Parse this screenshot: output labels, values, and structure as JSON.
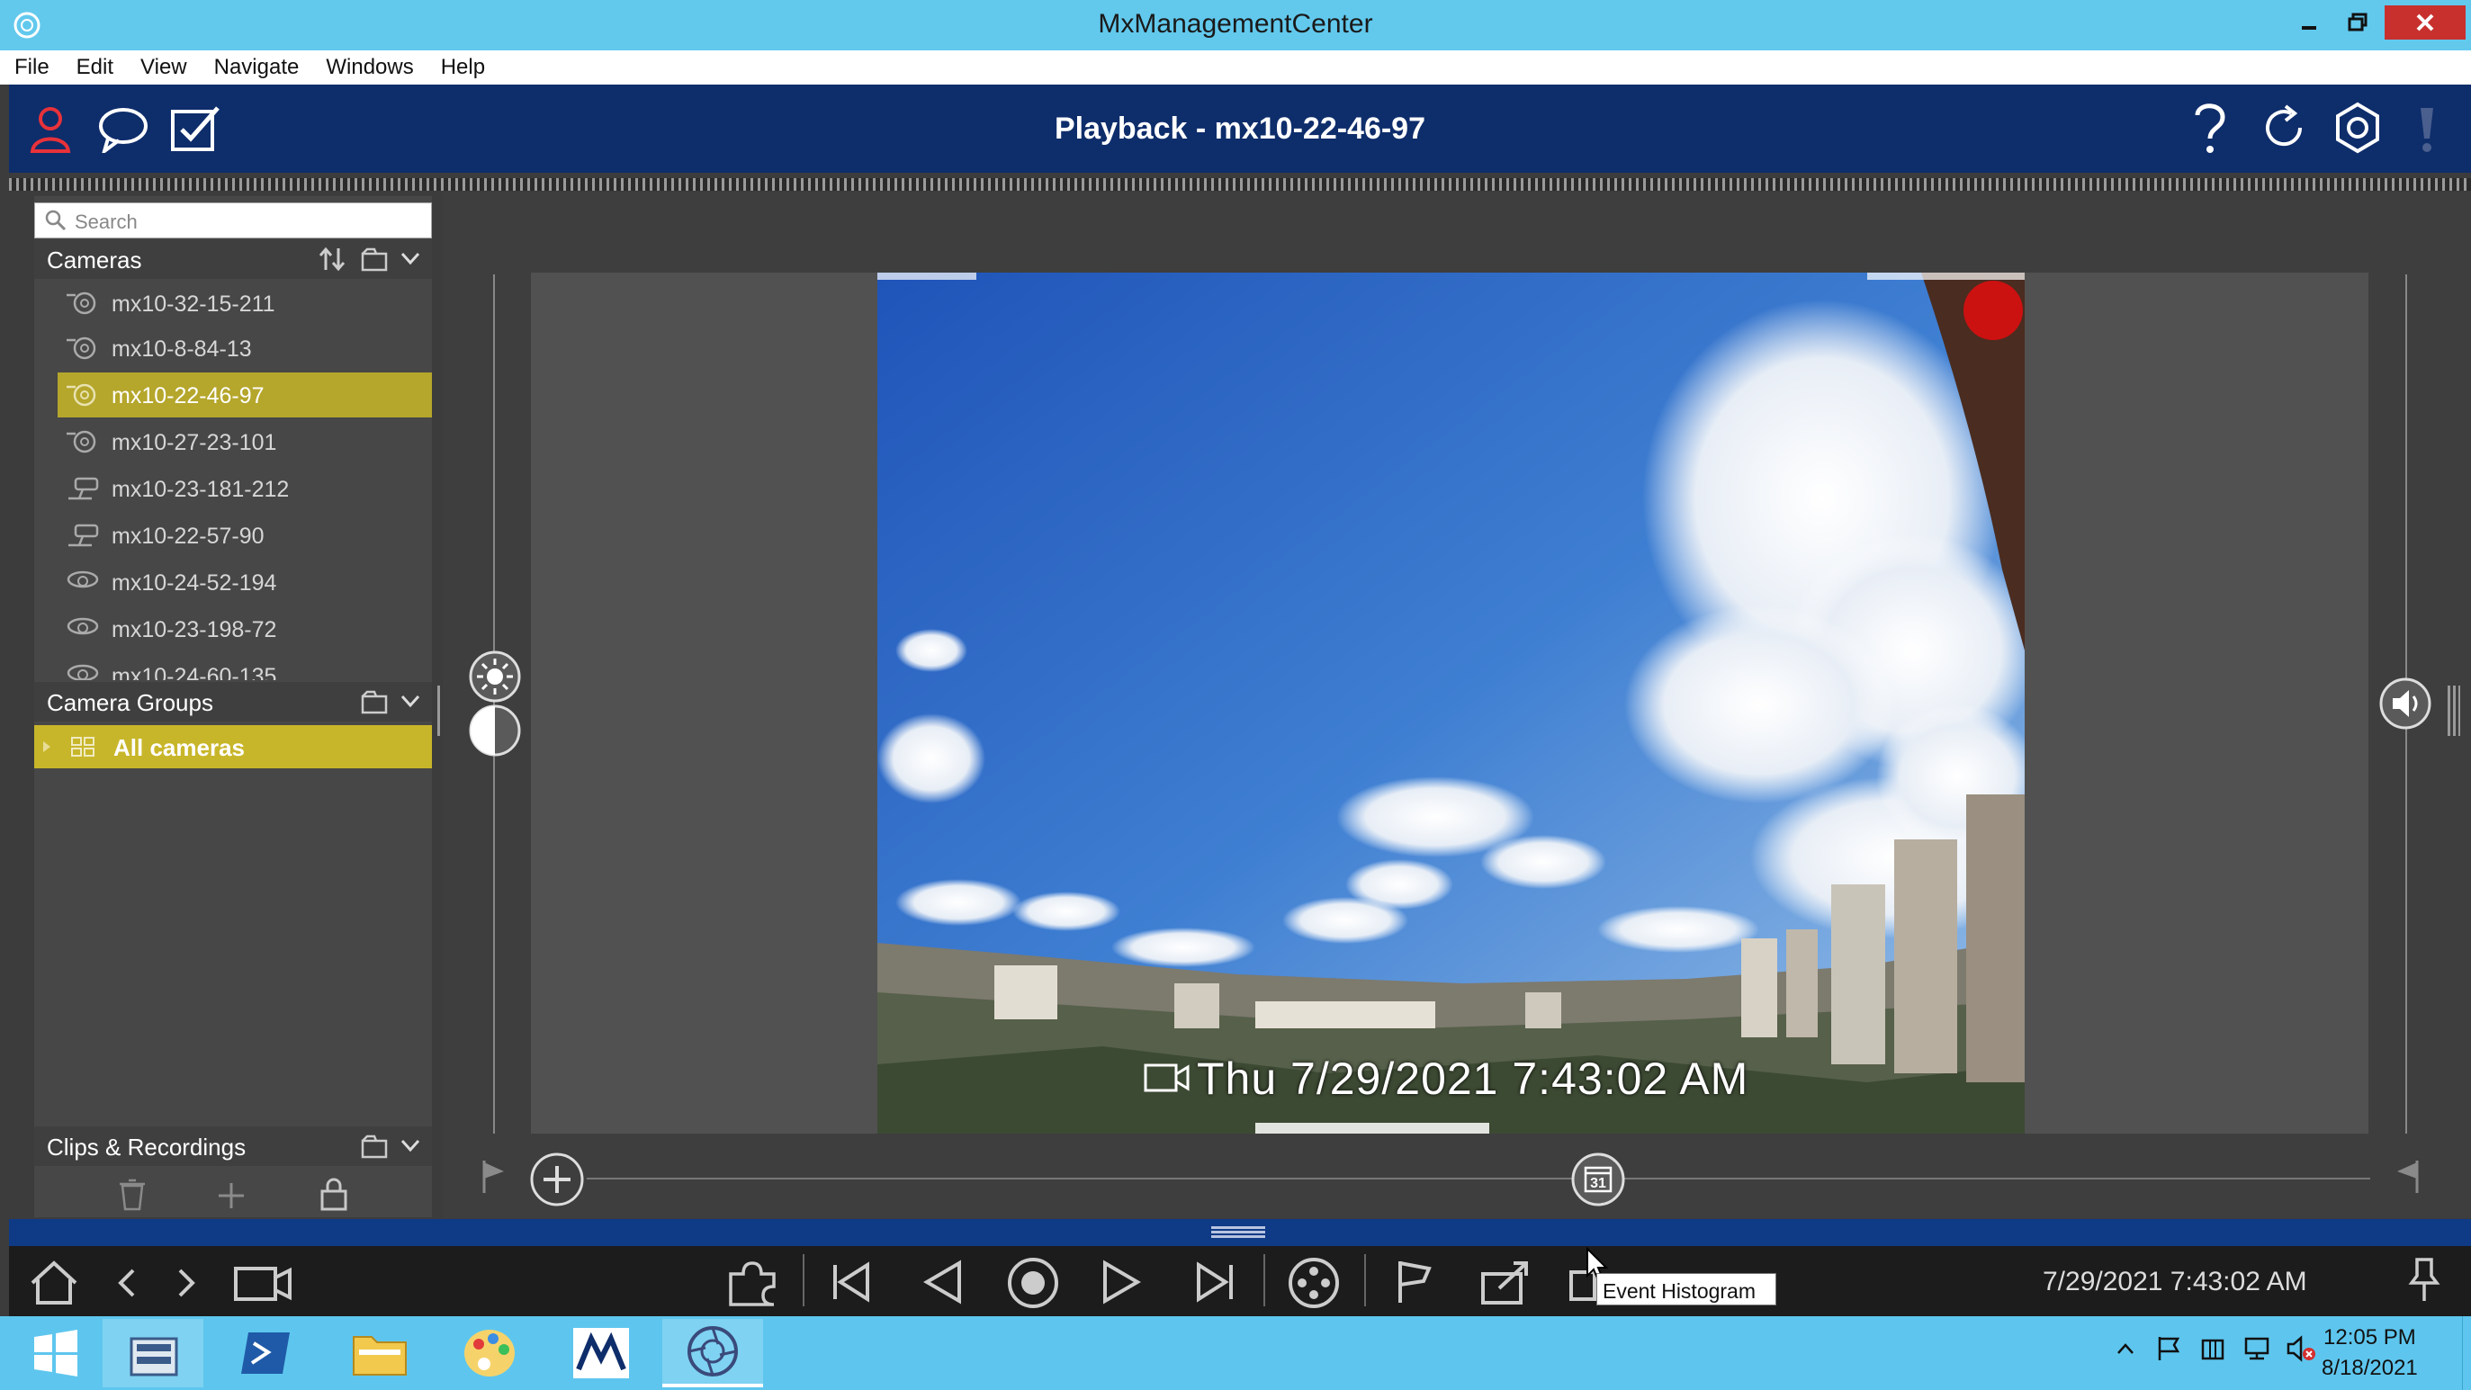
{
  "window": {
    "title": "MxManagementCenter"
  },
  "menu": {
    "items": [
      "File",
      "Edit",
      "View",
      "Navigate",
      "Windows",
      "Help"
    ]
  },
  "toolbar": {
    "page_title": "Playback - mx10-22-46-97"
  },
  "sidebar": {
    "search_placeholder": "Search",
    "cameras_header": "Cameras",
    "cameras": [
      {
        "label": "mx10-32-15-211",
        "icon": "dome-camera-icon",
        "selected": false
      },
      {
        "label": "mx10-8-84-13",
        "icon": "dome-camera-icon",
        "selected": false
      },
      {
        "label": "mx10-22-46-97",
        "icon": "dome-camera-icon",
        "selected": true
      },
      {
        "label": "mx10-27-23-101",
        "icon": "dome-camera-icon",
        "selected": false
      },
      {
        "label": "mx10-23-181-212",
        "icon": "bullet-camera-icon",
        "selected": false
      },
      {
        "label": "mx10-22-57-90",
        "icon": "bullet-camera-icon",
        "selected": false
      },
      {
        "label": "mx10-24-52-194",
        "icon": "fisheye-camera-icon",
        "selected": false
      },
      {
        "label": "mx10-23-198-72",
        "icon": "fisheye-camera-icon",
        "selected": false
      },
      {
        "label": "mx10-24-60-135",
        "icon": "fisheye-camera-icon",
        "selected": false
      }
    ],
    "camera_groups_header": "Camera Groups",
    "camera_groups": [
      {
        "label": "All cameras",
        "selected": true
      }
    ],
    "clips_header": "Clips & Recordings"
  },
  "video": {
    "timestamp": "Thu 7/29/2021 7:43:02 AM",
    "recording_indicator_color": "#cc1111"
  },
  "playback": {
    "datetime": "7/29/2021 7:43:02 AM",
    "tooltip": "Event Histogram",
    "calendar_day": "31"
  },
  "taskbar": {
    "time": "12:05 PM",
    "date": "8/18/2021"
  },
  "colors": {
    "titlebar": "#62c9ed",
    "toolbar": "#0e2d6b",
    "selection": "#b5a62c",
    "taskbar": "#5ec6ee"
  }
}
